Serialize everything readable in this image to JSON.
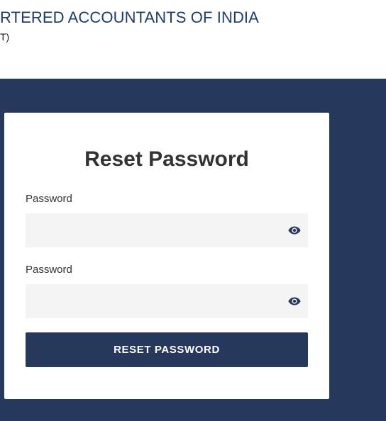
{
  "header": {
    "org_name": "RTERED ACCOUNTANTS OF INDIA",
    "org_sub": "T)"
  },
  "form": {
    "title": "Reset Password",
    "password_label": "Password",
    "password_value": "",
    "confirm_label": "Password",
    "confirm_value": "",
    "toggle_icon": "eye-icon",
    "submit_label": "RESET PASSWORD"
  },
  "colors": {
    "brand_navy": "#27385d",
    "header_text": "#1d3c6e",
    "field_bg": "#f4f4f4"
  }
}
